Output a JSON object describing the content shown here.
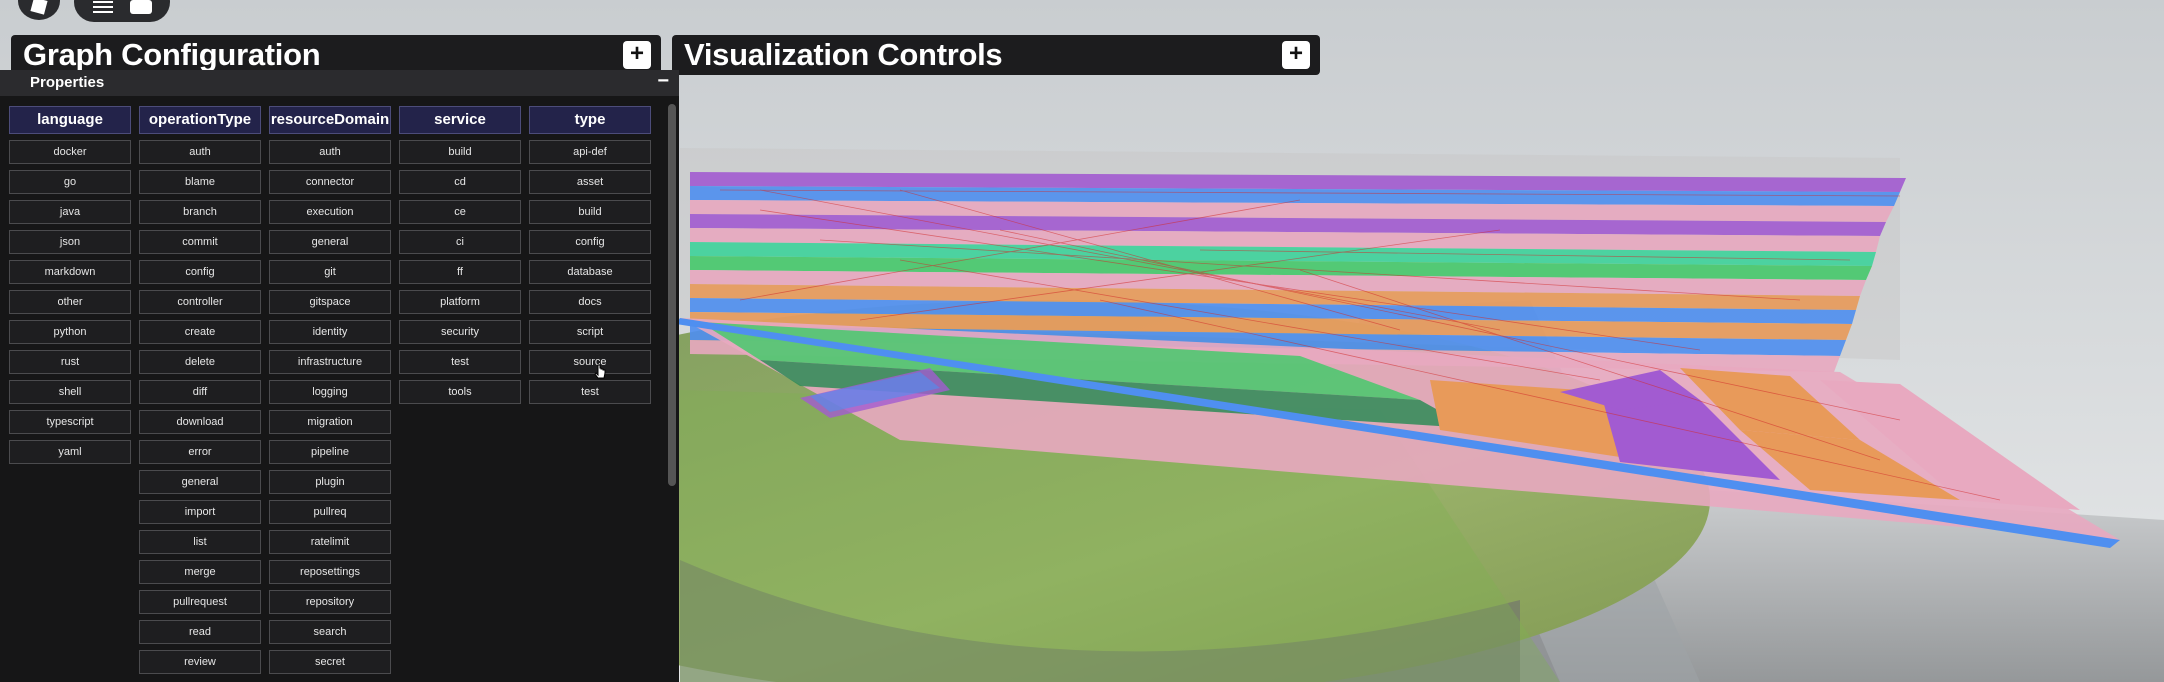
{
  "panels": {
    "graph_title": "Graph Configuration",
    "vis_title": "Visualization Controls",
    "add_symbol": "+",
    "properties_title": "Properties",
    "minimize_symbol": "−"
  },
  "columns": [
    {
      "header": "language",
      "items": [
        "docker",
        "go",
        "java",
        "json",
        "markdown",
        "other",
        "python",
        "rust",
        "shell",
        "typescript",
        "yaml"
      ]
    },
    {
      "header": "operationType",
      "items": [
        "auth",
        "blame",
        "branch",
        "commit",
        "config",
        "controller",
        "create",
        "delete",
        "diff",
        "download",
        "error",
        "general",
        "import",
        "list",
        "merge",
        "pullrequest",
        "read",
        "review"
      ]
    },
    {
      "header": "resourceDomain",
      "items": [
        "auth",
        "connector",
        "execution",
        "general",
        "git",
        "gitspace",
        "identity",
        "infrastructure",
        "logging",
        "migration",
        "pipeline",
        "plugin",
        "pullreq",
        "ratelimit",
        "reposettings",
        "repository",
        "search",
        "secret"
      ]
    },
    {
      "header": "service",
      "items": [
        "build",
        "cd",
        "ce",
        "ci",
        "ff",
        "platform",
        "security",
        "test",
        "tools"
      ]
    },
    {
      "header": "type",
      "items": [
        "api-def",
        "asset",
        "build",
        "config",
        "database",
        "docs",
        "script",
        "source",
        "test"
      ]
    }
  ],
  "colors": {
    "panel_bg": "#161617",
    "header_bg": "#23234a",
    "layer_colors": [
      "#a25bd1",
      "#4f8ff0",
      "#e8a9c0",
      "#46c96c",
      "#e89a5a",
      "#3fd39b"
    ]
  },
  "icons": [
    "roblox-logo-icon",
    "menu-icon",
    "chat-icon",
    "plus-icon",
    "minus-icon",
    "cursor-icon"
  ]
}
